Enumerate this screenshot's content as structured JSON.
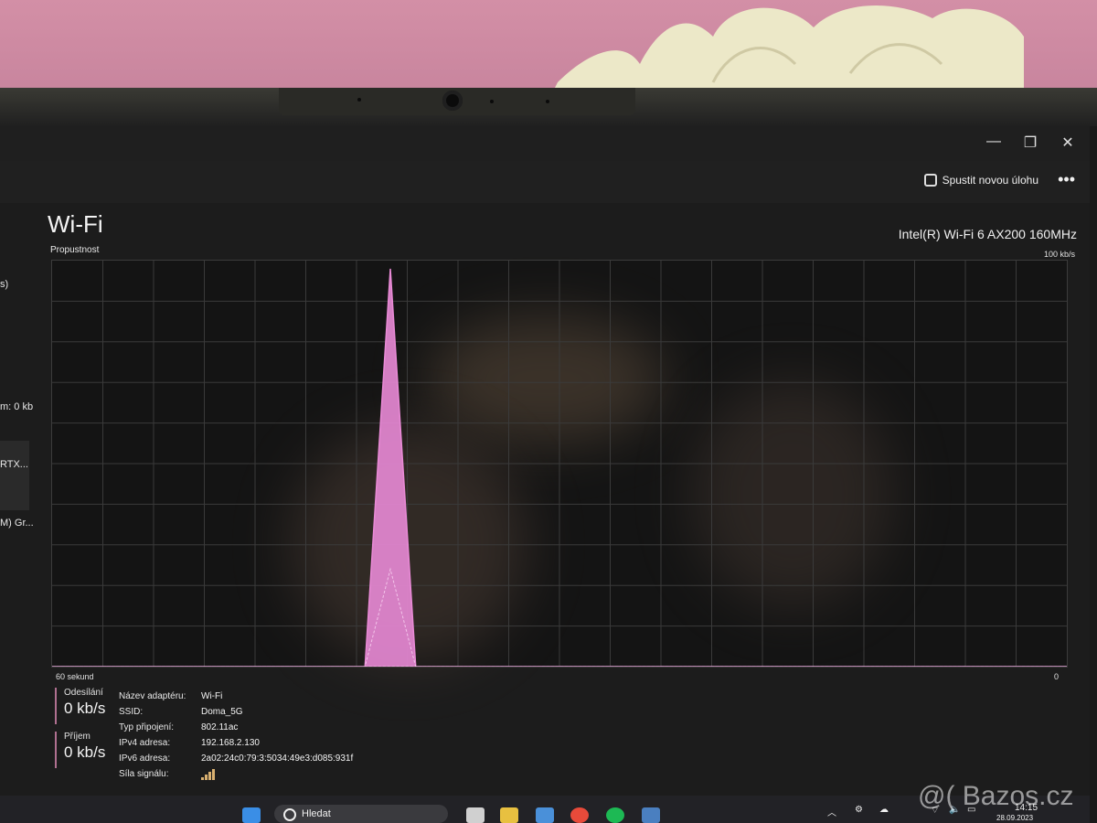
{
  "window": {
    "controls": {
      "minimize": "—",
      "maximize": "❐",
      "close": "✕"
    },
    "new_task_label": "Spustit novou úlohu",
    "more_label": "•••"
  },
  "sidebar": {
    "items": [
      "s)",
      "m: 0 kb",
      "RTX...",
      "M) Gr..."
    ]
  },
  "header": {
    "title": "Wi-Fi",
    "subtitle": "Propustnost",
    "adapter": "Intel(R) Wi-Fi 6 AX200 160MHz",
    "y_max_label": "100 kb/s"
  },
  "chart_data": {
    "type": "area",
    "x_label_left": "60 sekund",
    "x_label_right": "0",
    "y_max_label": "100 kb/s",
    "xlim": [
      60,
      0
    ],
    "ylim": [
      0,
      100
    ],
    "grid": true,
    "series": [
      {
        "x": [
          60,
          41.5,
          40,
          38.5,
          0
        ],
        "values": [
          0,
          0,
          98,
          0,
          0
        ],
        "color": "#e98ad6"
      },
      {
        "x": [
          60,
          41.5,
          40,
          38.5,
          0
        ],
        "values": [
          0,
          0,
          24,
          0,
          0
        ],
        "color": "#f3c4ea"
      }
    ]
  },
  "stats": {
    "send_label": "Odesílání",
    "send_value": "0 kb/s",
    "receive_label": "Příjem",
    "receive_value": "0 kb/s"
  },
  "properties": [
    {
      "key": "Název adaptéru:",
      "value": "Wi-Fi"
    },
    {
      "key": "SSID:",
      "value": "Doma_5G"
    },
    {
      "key": "Typ připojení:",
      "value": "802.11ac"
    },
    {
      "key": "IPv4 adresa:",
      "value": "192.168.2.130"
    },
    {
      "key": "IPv6 adresa:",
      "value": "2a02:24c0:79:3:5034:49e3:d085:931f"
    },
    {
      "key": "Síla signálu:",
      "value": ""
    }
  ],
  "taskbar": {
    "search_placeholder": "Hledat",
    "time": "14:15",
    "date": "28.09.2023"
  },
  "colors": {
    "accent": "#e98ad6",
    "stat_border": "#b07090"
  },
  "watermark": "@( Bazos.cz"
}
